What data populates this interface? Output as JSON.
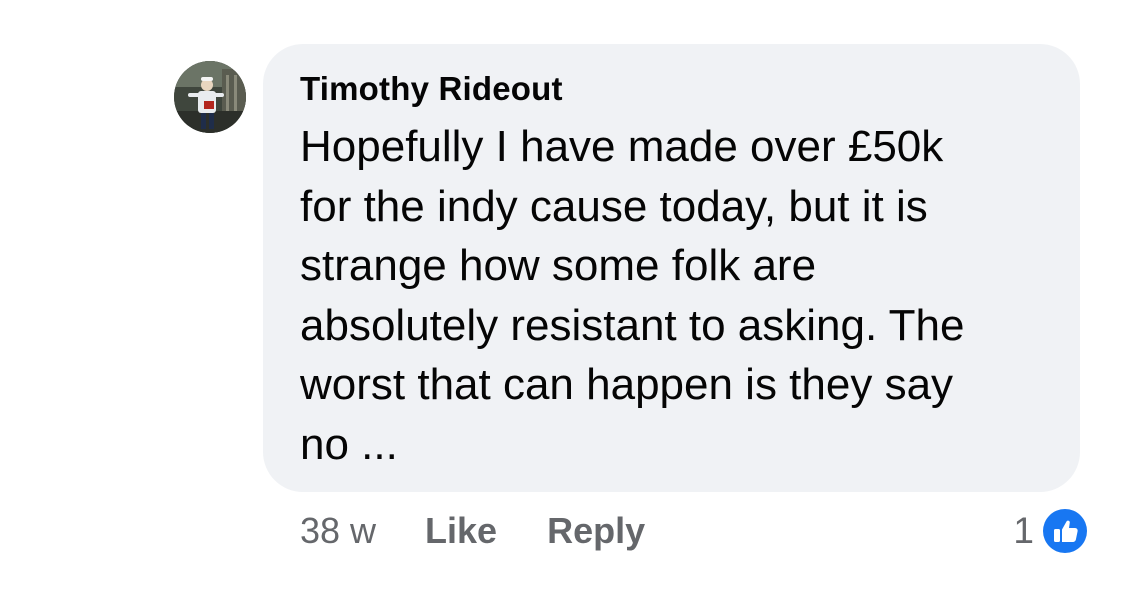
{
  "comment": {
    "author": "Timothy Rideout",
    "text": "Hopefully I have made over £50k\nfor the indy cause today, but it is\nstrange how some folk are\nabsolutely resistant to asking. The\nworst that can happen is they say\nno ...",
    "avatar_icon": "profile-photo"
  },
  "actions": {
    "timestamp": "38 w",
    "like_label": "Like",
    "reply_label": "Reply"
  },
  "reactions": {
    "count": "1",
    "icon": "thumbs-up-icon",
    "badge_color": "#1877f2"
  },
  "colors": {
    "bubble": "#f0f2f5",
    "text": "#050505",
    "secondary_text": "#65676b"
  }
}
